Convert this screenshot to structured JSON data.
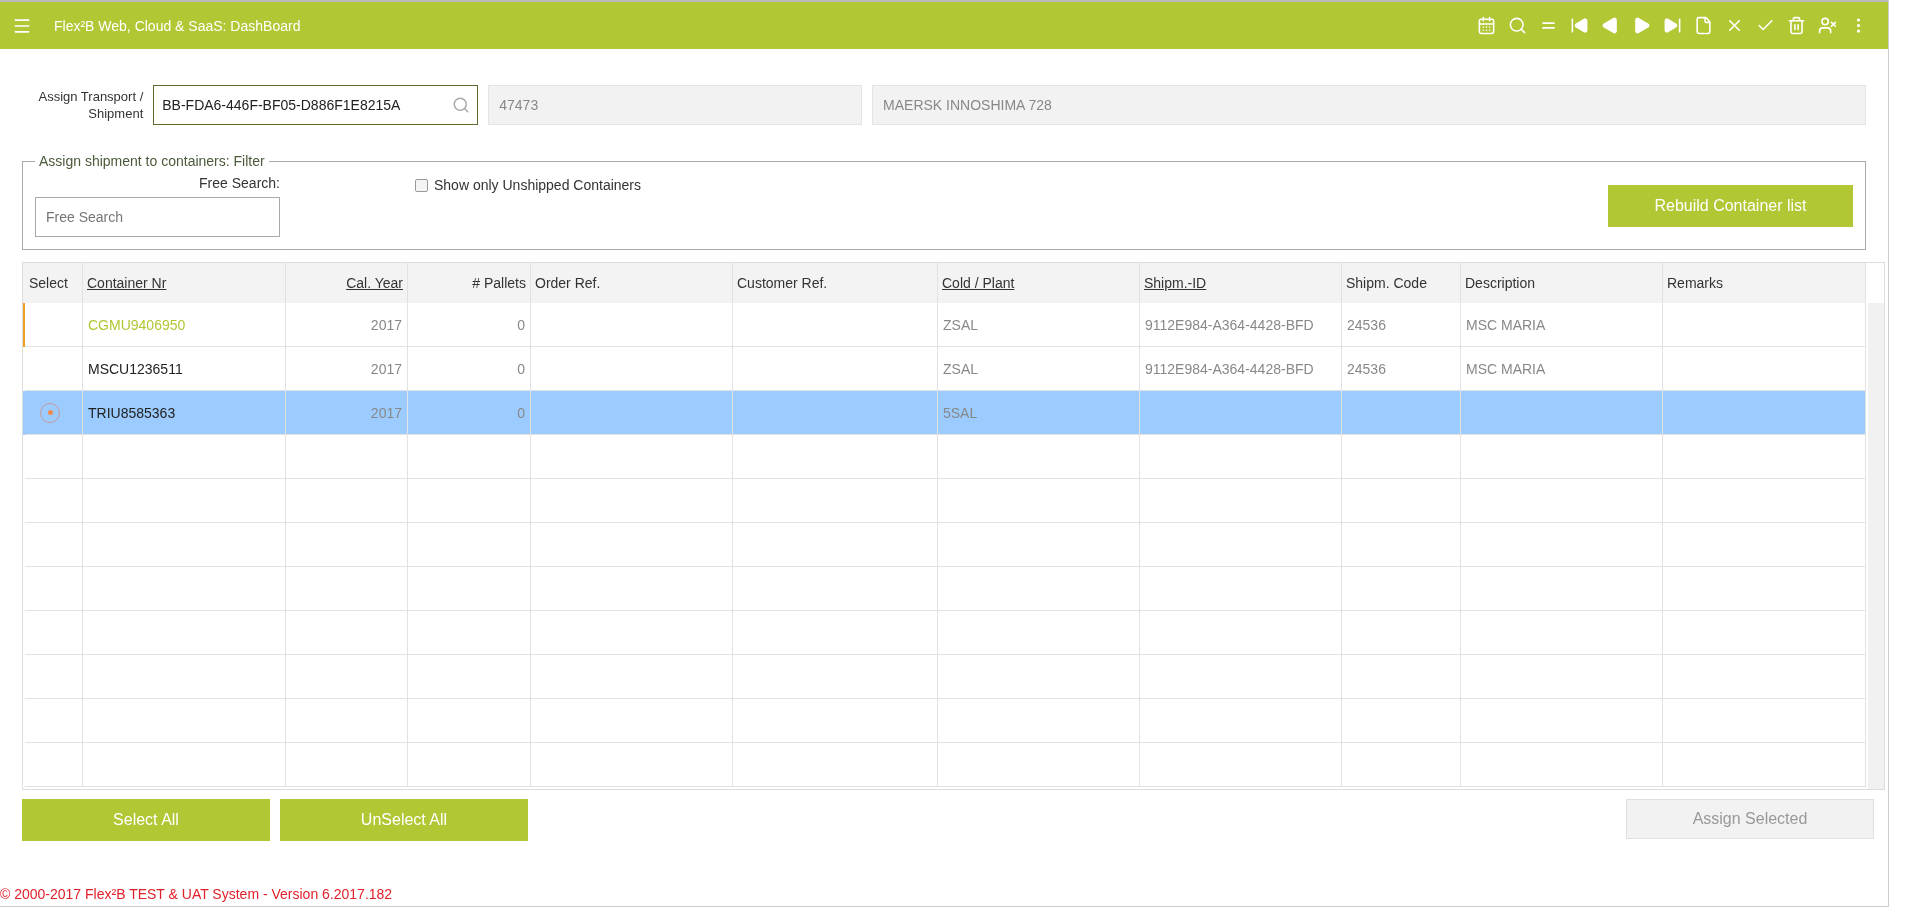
{
  "header": {
    "title": "Flex²B Web, Cloud & SaaS: DashBoard"
  },
  "transport": {
    "label": "Assign Transport / Shipment",
    "value": "BB-FDA6-446F-BF05-D886F1E8215A",
    "number": "47473",
    "vessel": "MAERSK INNOSHIMA 728"
  },
  "filter": {
    "legend": "Assign shipment to containers: Filter",
    "search_label": "Free Search:",
    "search_placeholder": "Free Search",
    "checkbox": {
      "label": "Show only Unshipped Containers",
      "checked": false
    },
    "rebuild_button": "Rebuild Container list"
  },
  "table": {
    "columns": [
      {
        "label": "Select",
        "sortable": false,
        "kind": "text"
      },
      {
        "label": "Container Nr",
        "sortable": true,
        "kind": "text"
      },
      {
        "label": "Cal. Year",
        "sortable": true,
        "kind": "number"
      },
      {
        "label": "# Pallets",
        "sortable": false,
        "kind": "number"
      },
      {
        "label": "Order Ref.",
        "sortable": false,
        "kind": "text"
      },
      {
        "label": "Customer Ref.",
        "sortable": false,
        "kind": "text"
      },
      {
        "label": "Cold / Plant",
        "sortable": true,
        "kind": "text"
      },
      {
        "label": "Shipm.-ID",
        "sortable": true,
        "kind": "text"
      },
      {
        "label": "Shipm. Code",
        "sortable": false,
        "kind": "text"
      },
      {
        "label": "Description",
        "sortable": false,
        "kind": "text"
      },
      {
        "label": "Remarks",
        "sortable": false,
        "kind": "text"
      }
    ],
    "rows": [
      {
        "selected": false,
        "current": true,
        "cells": [
          "",
          "CGMU9406950",
          "2017",
          "0",
          "",
          "",
          "ZSAL",
          "9112E984-A364-4428-BFD",
          "24536",
          "MSC MARIA",
          ""
        ]
      },
      {
        "selected": false,
        "current": false,
        "cells": [
          "",
          "MSCU1236511",
          "2017",
          "0",
          "",
          "",
          "ZSAL",
          "9112E984-A364-4428-BFD",
          "24536",
          "MSC MARIA",
          ""
        ]
      },
      {
        "selected": true,
        "current": false,
        "cells": [
          "",
          "TRIU8585363",
          "2017",
          "0",
          "",
          "",
          "5SAL",
          "",
          "",
          "",
          ""
        ]
      }
    ]
  },
  "buttons": {
    "select_all": "Select All",
    "unselect_all": "UnSelect All",
    "assign": {
      "label": "Assign Selected",
      "disabled": true
    }
  },
  "footer": "© 2000-2017 Flex²B TEST & UAT System - Version 6.2017.182"
}
